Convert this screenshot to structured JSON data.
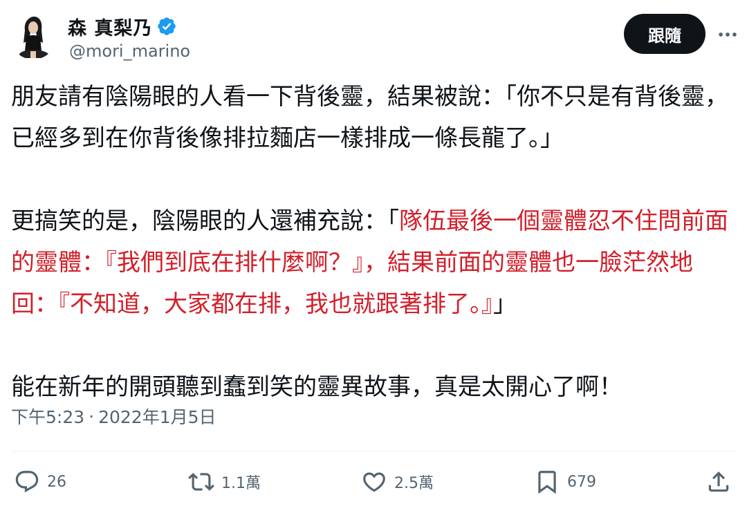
{
  "author": {
    "display_name": "森 真梨乃",
    "handle": "@mori_marino",
    "verified_color": "#1d9bf0",
    "avatar_icon": "avatar-photo"
  },
  "header": {
    "follow_label": "跟隨",
    "more_icon": "more-dots-icon"
  },
  "tweet": {
    "paragraphs": [
      {
        "segments": [
          {
            "text": "朋友請有陰陽眼的人看一下背後靈，結果被說：「你不只是有背後靈，已經多到在你背後像排拉麵店一樣排成一條長龍了。」",
            "color": "normal"
          }
        ]
      },
      {
        "segments": [
          {
            "text": "更搞笑的是，陰陽眼的人還補充說：「",
            "color": "normal"
          },
          {
            "text": "隊伍最後一個靈體忍不住問前面的靈體：『我們到底在排什麼啊？』，結果前面的靈體也一臉茫然地回：『不知道，大家都在排，我也就跟著排了。』",
            "color": "red"
          },
          {
            "text": "」",
            "color": "normal"
          }
        ]
      },
      {
        "segments": [
          {
            "text": "能在新年的開頭聽到蠢到笑的靈異故事，真是太開心了啊！",
            "color": "normal"
          }
        ]
      }
    ],
    "highlight_color": "#d21f2a"
  },
  "meta": {
    "time": "下午5:23",
    "separator": "·",
    "date": "2022年1月5日"
  },
  "actions": {
    "reply_count": "26",
    "retweet_count": "1.1萬",
    "like_count": "2.5萬",
    "bookmark_count": "679"
  }
}
